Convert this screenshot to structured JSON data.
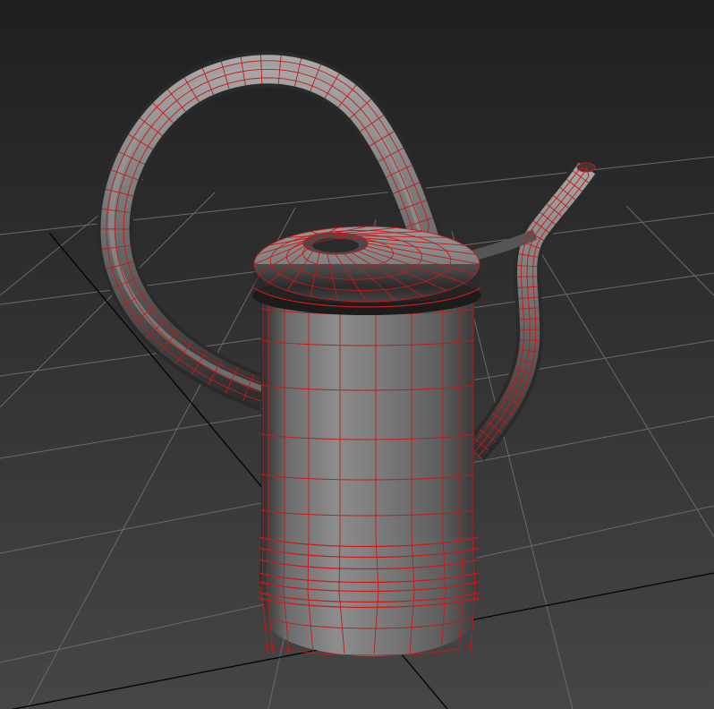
{
  "viewport": {
    "label": "",
    "shading_mode": "Edged Faces",
    "wire_color": "#c41a1a",
    "grid_color": "#6a6a6a",
    "axis_color": "#050505",
    "background_top": "#1f1f1f",
    "background_bottom": "#464646"
  },
  "scene": {
    "object": "watering-can",
    "parts": [
      "handle",
      "spout",
      "lid",
      "body",
      "base"
    ]
  }
}
